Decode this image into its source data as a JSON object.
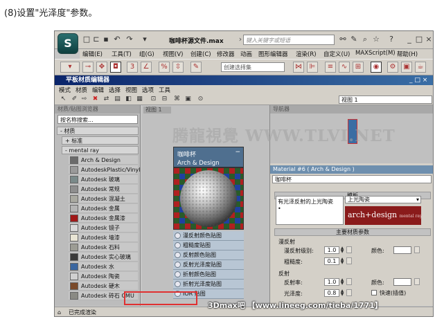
{
  "caption": "(8)设置\"光泽度\"参数。",
  "app": {
    "logo_glyph": "S",
    "doc_title": "咖啡杯源文件.max",
    "search_placeholder": "键入关键字或短语",
    "menu": [
      "编辑(E)",
      "工具(T)",
      "组(G)",
      "视图(V)",
      "创建(C)",
      "修改器",
      "动画",
      "图形编辑器",
      "渲染(R)",
      "自定义(U)",
      "MAXScript(M)",
      "帮助(H)"
    ],
    "selection_set": "创建选择集"
  },
  "slate": {
    "title": "平板材质编辑器",
    "menu": [
      "模式",
      "材质",
      "编辑",
      "选择",
      "视图",
      "选项",
      "工具"
    ],
    "view_select": "视图 1"
  },
  "browser": {
    "title": "材质/贴图浏览器",
    "search": "按名称搜索...",
    "groups": {
      "materials": "- 材质",
      "standard": "+ 标准",
      "mentalray": "- mental ray"
    },
    "items": [
      {
        "label": "Arch & Design",
        "color": "#6b6b6b"
      },
      {
        "label": "AutodeskPlastic/Vinyl",
        "color": "#9a9a9a"
      },
      {
        "label": "Autodesk 玻璃",
        "color": "#7a8a8a"
      },
      {
        "label": "Autodesk 常规",
        "color": "#8e8e8e"
      },
      {
        "label": "Autodesk 混凝土",
        "color": "#a9a9a0"
      },
      {
        "label": "Autodesk 金属",
        "color": "#b4b4b4"
      },
      {
        "label": "Autodesk 金属漆",
        "color": "#a01818"
      },
      {
        "label": "Autodesk 镜子",
        "color": "#d8d8d8"
      },
      {
        "label": "Autodesk 墙漆",
        "color": "#e8e4d4"
      },
      {
        "label": "Autodesk 石料",
        "color": "#9c9c94"
      },
      {
        "label": "Autodesk 实心玻璃",
        "color": "#3a3a3a"
      },
      {
        "label": "Autodesk 水",
        "color": "#3a66a0"
      },
      {
        "label": "Autodesk 陶瓷",
        "color": "#d0d0d0"
      },
      {
        "label": "Autodesk 硬木",
        "color": "#7a4a2a"
      },
      {
        "label": "Autodesk 砖石 CMU",
        "color": "#8a8a84"
      }
    ]
  },
  "view": {
    "tab": "视图 1",
    "watermark": "腾龍視覺 WWW.TLVI.NET"
  },
  "node": {
    "title": "咖啡杯",
    "subtitle": "Arch & Design",
    "slots": [
      "漫反射颜色贴图",
      "粗糙度贴图",
      "反射颜色贴图",
      "反射光泽度贴图",
      "折射颜色贴图",
      "折射光泽度贴图",
      "IOR 贴图"
    ]
  },
  "navigator": {
    "title": "导航器"
  },
  "properties": {
    "header": "Material #6 ( Arch & Design )",
    "material_name": "咖啡杯",
    "templates_rollout": "模板",
    "template_desc": "有光泽反射的上光陶瓷",
    "template_bullet": "•",
    "template_select": "上光陶瓷",
    "arch_logo": "arch+design",
    "arch_logo_sub": "mental ray",
    "main_rollout": "主要材质参数",
    "diffuse_group": "漫反射",
    "diffuse_level_label": "漫反射级别:",
    "diffuse_level": "1.0",
    "roughness_label": "粗糙度:",
    "roughness": "0.1",
    "color_label": "颜色:",
    "reflection_group": "反射",
    "reflectivity_label": "反射率:",
    "reflectivity": "1.0",
    "glossiness_label": "光泽度:",
    "glossiness": "0.8",
    "fast_interp_label": "快速(插值)",
    "reflection_color_label": "颜色:"
  },
  "statusbar": {
    "text": "已完成渲染"
  },
  "bottom_watermark": "3Dmax吧 【www.lineeg.com/tieba/1771】"
}
